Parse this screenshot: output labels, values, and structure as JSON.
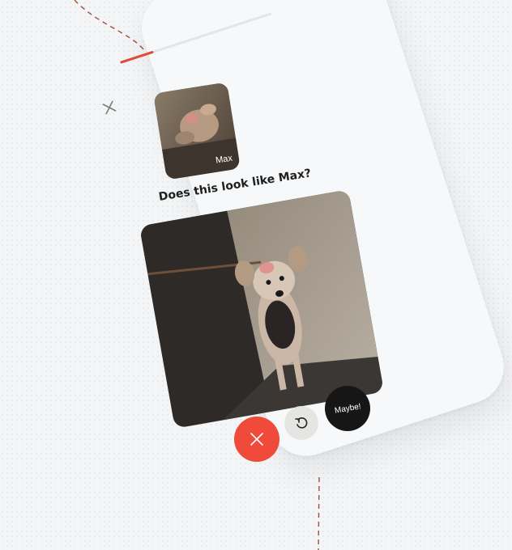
{
  "header": {
    "close_icon": "close-icon",
    "progress": 0.22
  },
  "reference": {
    "pet_name_label": "Max"
  },
  "question": {
    "text": "Does this look like Max?"
  },
  "actions": {
    "nope_icon": "x-icon",
    "undo_icon": "undo-icon",
    "maybe_label": "Maybe!"
  },
  "colors": {
    "accent_red": "#ef4a3a",
    "dark": "#161616",
    "neutral": "#e5e5e4",
    "path": "#a0523f"
  }
}
